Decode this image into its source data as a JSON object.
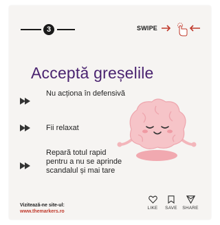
{
  "step": {
    "number": "3"
  },
  "swipe": {
    "label": "SWIPE"
  },
  "headline": "Acceptă greșelile",
  "tips": [
    {
      "text": "Nu acționa în defensivă"
    },
    {
      "text": "Fii relaxat"
    },
    {
      "text": "Repară totul rapid pentru a nu se aprinde scandalul și mai tare"
    }
  ],
  "cta": {
    "label": "Vizitează-ne site-ul:",
    "url": "www.themarkers.ro"
  },
  "actions": {
    "like": "LIKE",
    "save": "SAVE",
    "share": "SHARE"
  },
  "colors": {
    "headline": "#4a2370",
    "url": "#c0392b",
    "accent": "#d6336c",
    "brain": "#f6c4c8"
  },
  "icons": [
    "arrow-right-icon",
    "hand-tap-icon",
    "arrow-left-icon",
    "bullet-arrow-icon",
    "brain-illustration",
    "heart-icon",
    "bookmark-icon",
    "share-icon"
  ]
}
